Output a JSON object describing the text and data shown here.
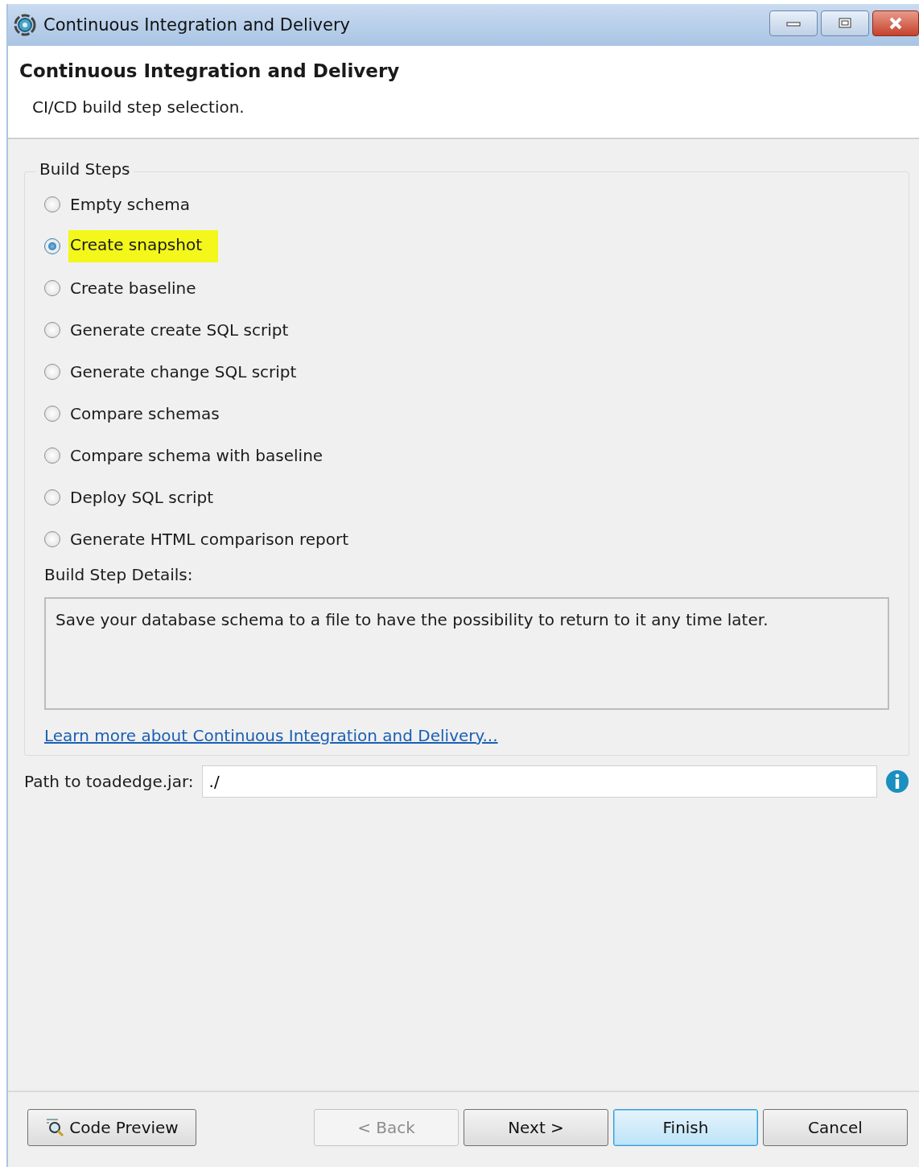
{
  "window": {
    "title": "Continuous Integration and Delivery"
  },
  "header": {
    "title": "Continuous Integration and Delivery",
    "description": "CI/CD build step selection."
  },
  "build_steps": {
    "legend": "Build Steps",
    "options": [
      {
        "label": "Empty schema",
        "selected": false,
        "highlighted": false
      },
      {
        "label": "Create snapshot",
        "selected": true,
        "highlighted": true
      },
      {
        "label": "Create baseline",
        "selected": false,
        "highlighted": false
      },
      {
        "label": "Generate create SQL script",
        "selected": false,
        "highlighted": false
      },
      {
        "label": "Generate change SQL script",
        "selected": false,
        "highlighted": false
      },
      {
        "label": "Compare schemas",
        "selected": false,
        "highlighted": false
      },
      {
        "label": "Compare schema with baseline",
        "selected": false,
        "highlighted": false
      },
      {
        "label": "Deploy SQL script",
        "selected": false,
        "highlighted": false
      },
      {
        "label": "Generate HTML comparison report",
        "selected": false,
        "highlighted": false
      }
    ],
    "details_label": "Build Step Details:",
    "details_text": "Save your database schema to a file to have the possibility to return to it any time later.",
    "link": "Learn more about Continuous Integration and Delivery..."
  },
  "path_field": {
    "label": "Path to toadedge.jar:",
    "value": "./"
  },
  "buttons": [
    {
      "label": "Code Preview",
      "kind": "preview",
      "disabled": false,
      "default": false
    },
    {
      "label": "< Back",
      "kind": "nav",
      "disabled": true,
      "default": false
    },
    {
      "label": "Next >",
      "kind": "nav",
      "disabled": false,
      "default": false
    },
    {
      "label": "Finish",
      "kind": "nav",
      "disabled": false,
      "default": true
    },
    {
      "label": "Cancel",
      "kind": "nav",
      "disabled": false,
      "default": false
    }
  ]
}
